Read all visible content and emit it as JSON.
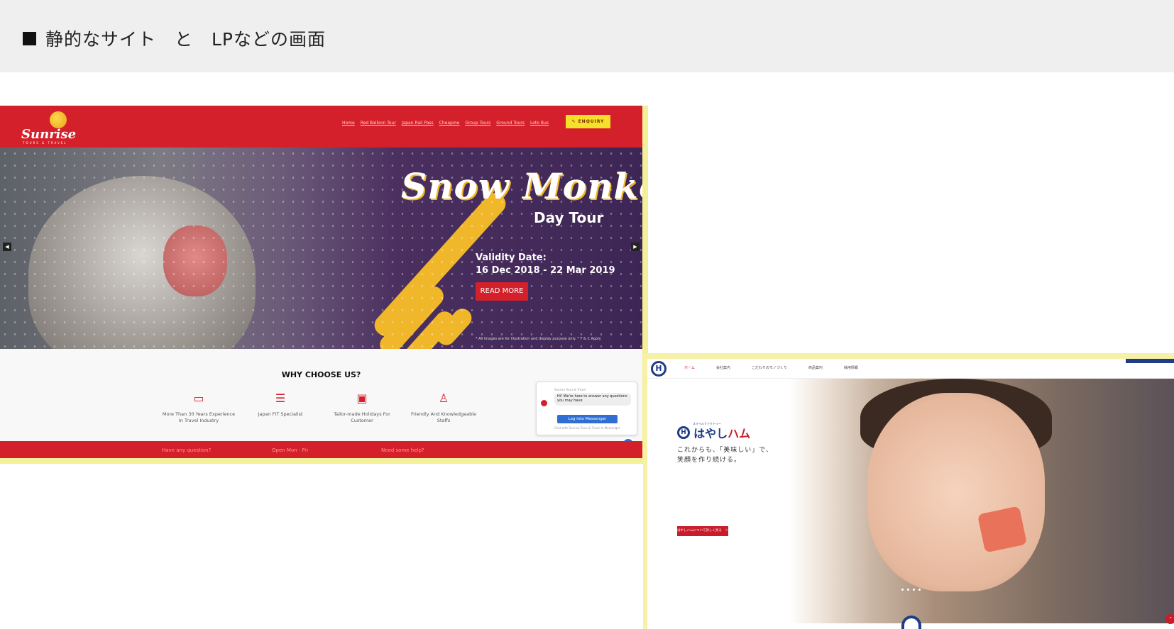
{
  "header": {
    "title": "静的なサイト　と　LPなどの画面"
  },
  "sunrise": {
    "logo": {
      "name": "Sunrise",
      "subtitle": "TOURS & TRAVEL"
    },
    "menu": [
      "Home",
      "Red Balloon Tour",
      "Japan Rail Pass",
      "Cheapme",
      "Group Tours",
      "Ground Tours",
      "Loto Bus"
    ],
    "enquiry": "✎ ENQUIRY",
    "hero": {
      "title": "Snow Monkey",
      "subtitle": "Day Tour",
      "validity_label": "Validity Date:",
      "validity_range": "16 Dec 2018 - 22 Mar 2019",
      "button": "READ MORE",
      "note": "* All images are for illustration and display purpose only. * T & C Apply"
    },
    "why": {
      "title": "WHY CHOOSE US?",
      "features": [
        {
          "icon": "certificate-icon",
          "label": "More Than 30 Years Experience In Travel Industry"
        },
        {
          "icon": "document-icon",
          "label": "Japan FIT Specialist"
        },
        {
          "icon": "briefcase-icon",
          "label": "Tailor-made Holidays For Customer"
        },
        {
          "icon": "person-icon",
          "label": "Friendly And Knowledgeable Staffs"
        }
      ]
    },
    "chat": {
      "header": "Sunrise Tours & Travel",
      "message": "Hi! We're here to answer any questions you may have",
      "button": "Log into Messenger",
      "footer": "Chat with Sunrise Tours & Travel in Messenger"
    },
    "bottom_bar": [
      "Have any question?",
      "Open Mon - Fri",
      "Need some help?"
    ]
  },
  "hayashi": {
    "menu": [
      {
        "label": "ホーム",
        "active": true
      },
      {
        "label": "会社案内",
        "active": false
      },
      {
        "label": "こだわりのモノづくり",
        "active": false
      },
      {
        "label": "商品案内",
        "active": false
      },
      {
        "label": "採用情報",
        "active": false
      }
    ],
    "brand_tag": "スマイルファクトリー",
    "brand_name_main": "はやし",
    "brand_name_accent": "ハム",
    "copy_line1": "これからも、「美味しい」で、",
    "copy_line2": "笑顔を作り続ける。",
    "cta": "はやしハムについて詳しく見る　＞",
    "colors": {
      "primary": "#1f3c8a",
      "accent": "#c91c2b"
    }
  }
}
